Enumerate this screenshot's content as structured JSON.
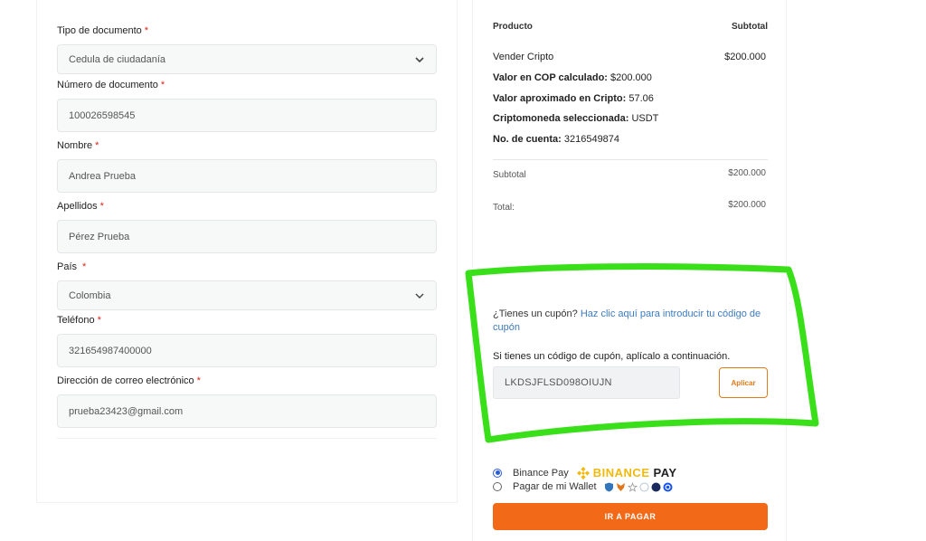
{
  "form": {
    "doc_type": {
      "label": "Tipo de documento",
      "value": "Cedula de ciudadanía"
    },
    "doc_number": {
      "label": "Número de documento",
      "value": "100026598545"
    },
    "name": {
      "label": "Nombre",
      "value": "Andrea Prueba"
    },
    "surname": {
      "label": "Apellidos",
      "value": "Pérez Prueba"
    },
    "country": {
      "label": "País",
      "value": "Colombia"
    },
    "phone": {
      "label": "Teléfono",
      "value": "321654987400000"
    },
    "email": {
      "label": "Dirección de correo electrónico",
      "value": "prueba23423@gmail.com"
    },
    "required_mark": "*"
  },
  "summary": {
    "col_product": "Producto",
    "col_subtotal": "Subtotal",
    "item_name": "Vender Cripto",
    "item_price": "$200.000",
    "cop_label": "Valor en COP calculado:",
    "cop_value": "$200.000",
    "crypto_label": "Valor aproximado en Cripto:",
    "crypto_value": "57.06",
    "coin_label": "Criptomoneda seleccionada:",
    "coin_value": "USDT",
    "account_label": "No. de cuenta:",
    "account_value": "3216549874",
    "subtotal_label": "Subtotal",
    "subtotal_value": "$200.000",
    "total_label": "Total:",
    "total_value": "$200.000"
  },
  "coupon": {
    "question": "¿Tienes un cupón?",
    "link": "Haz clic aquí para introducir tu código de cupón",
    "note": "Si tienes un código de cupón, aplícalo a continuación.",
    "code": "LKDSJFLSD098OIUJN",
    "apply": "Aplicar"
  },
  "payment": {
    "binance_label": "Binance Pay",
    "binance_logo_word": "BINANCE",
    "binance_logo_pay": "PAY",
    "wallet_label": "Pagar de mi Wallet",
    "selected": "binance",
    "submit": "IR A PAGAR"
  },
  "colors": {
    "accent": "#f26a18",
    "link": "#3d7bbf",
    "binance_yellow": "#f0b90b",
    "highlight_green": "#39e01a"
  }
}
